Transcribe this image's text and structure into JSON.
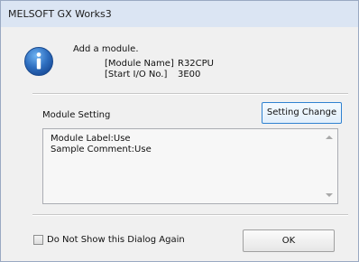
{
  "window": {
    "title": "MELSOFT GX Works3"
  },
  "message": {
    "main": "Add a module.",
    "module_name_label": "[Module Name]",
    "module_name_value": "R32CPU",
    "start_io_label": "[Start I/O No.]",
    "start_io_value": "3E00"
  },
  "module_setting": {
    "label": "Module Setting",
    "button_label": "Setting Change",
    "lines": [
      "Module Label:Use",
      "Sample Comment:Use"
    ]
  },
  "footer": {
    "checkbox_label": "Do Not Show this Dialog Again",
    "checkbox_checked": false,
    "ok_label": "OK"
  },
  "icons": {
    "info": "info-icon",
    "scroll_up": "scroll-up-arrow-icon",
    "scroll_down": "scroll-down-arrow-icon"
  },
  "colors": {
    "titlebar": "#dbe5f3",
    "dialog_bg": "#f0f0f0",
    "focus_border": "#2f82d1",
    "info_icon": "#2f6fc0"
  }
}
